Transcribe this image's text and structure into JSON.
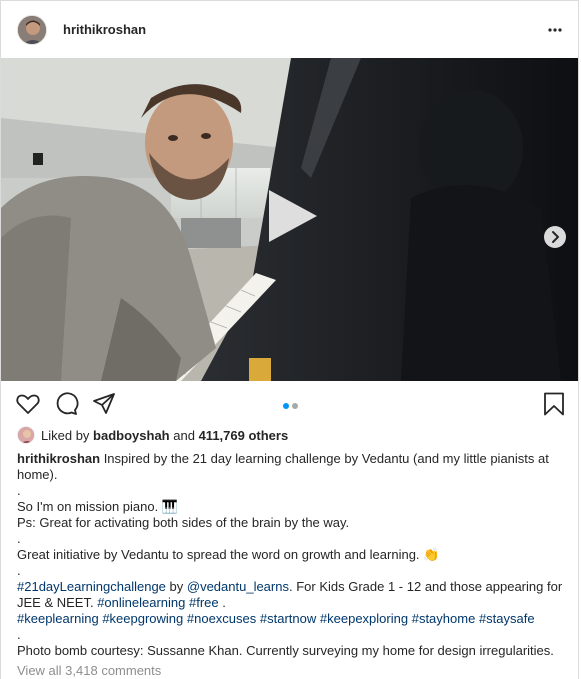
{
  "header": {
    "username": "hrithikroshan",
    "more_icon": "more-horizontal-icon"
  },
  "media": {
    "play_icon": "play-icon",
    "next_icon": "chevron-right-icon",
    "slide_count": 2,
    "current_slide": 1
  },
  "actions": {
    "like_icon": "heart-icon",
    "comment_icon": "comment-icon",
    "share_icon": "paper-plane-icon",
    "save_icon": "bookmark-icon"
  },
  "likes": {
    "prefix": "Liked by",
    "user": "badboyshah",
    "middle": "and",
    "count": "411,769 others"
  },
  "caption": {
    "username": "hrithikroshan",
    "line1": " Inspired by the 21 day learning challenge by Vedantu (and my little pianists at home).",
    "dot1": ".",
    "line2": "So I'm on mission piano. 🎹",
    "line3": "Ps: Great for activating both sides of the brain by the way.",
    "dot2": ".",
    "line4": "Great initiative by Vedantu to spread the word on growth and learning. 👏",
    "dot3": ".",
    "tag_21day": "#21dayLearningchallenge",
    "by": " by ",
    "mention": "@vedantu_learns",
    "line5_rest": ". For Kids Grade 1 - 12 and those appearing for JEE & NEET. ",
    "tag_onlinelearning": "#onlinelearning",
    "tag_free": "#free",
    "line5_end": " .",
    "tag_keeplearning": "#keeplearning",
    "tag_keepgrowing": "#keepgrowing",
    "tag_noexcuses": "#noexcuses",
    "tag_startnow": "#startnow",
    "tag_keepexploring": "#keepexploring",
    "tag_stayhome": "#stayhome",
    "tag_staysafe": "#staysafe",
    "dot4": ".",
    "line6": "Photo bomb courtesy: Sussanne Khan. Currently surveying my home for design irregularities."
  },
  "comments": {
    "view_all": "View all 3,418 comments"
  },
  "colors": {
    "link": "#00376b",
    "active_dot": "#0095f6",
    "inactive_dot": "#a8a8a8",
    "muted": "#8e8e8e"
  }
}
